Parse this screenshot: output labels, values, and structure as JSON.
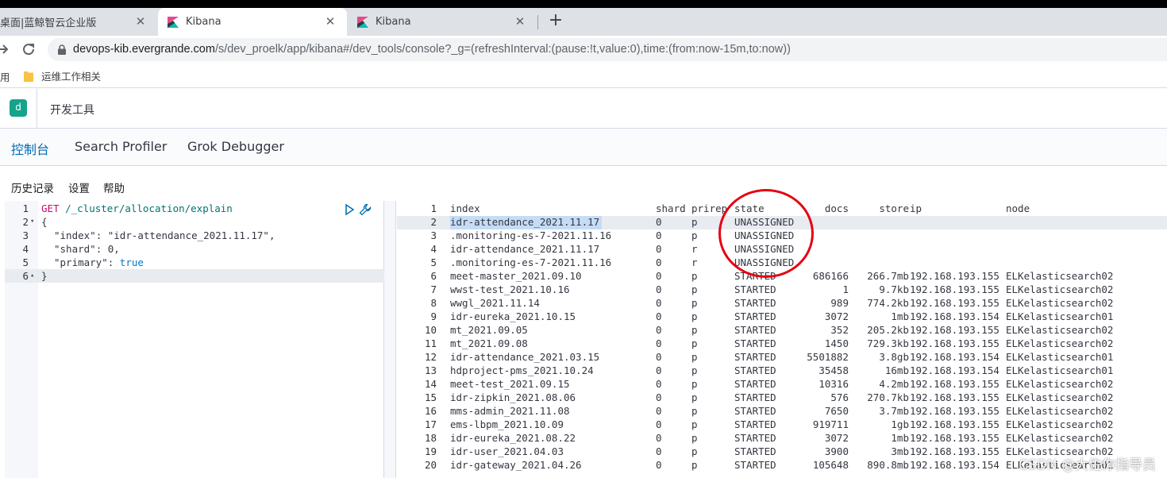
{
  "browser": {
    "tabs": [
      {
        "title": "桌面|蓝鲸智云企业版",
        "active": false
      },
      {
        "title": "Kibana",
        "active": true
      },
      {
        "title": "Kibana",
        "active": false
      }
    ],
    "close_glyph": "✕",
    "new_tab_glyph": "+",
    "url_host": "devops-kib.evergrande.com",
    "url_path": "/s/dev_proelk/app/kibana#/dev_tools/console?_g=(refreshInterval:(pause:!t,value:0),time:(from:now-15m,to:now))",
    "bookmarks": {
      "apps_label": "用",
      "folder_label": "运维工作相关"
    }
  },
  "kibana": {
    "space_initial": "d",
    "app_title": "开发工具",
    "tabs": [
      "控制台",
      "Search Profiler",
      "Grok Debugger"
    ],
    "active_tab": 0,
    "subnav": [
      "历史记录",
      "设置",
      "帮助"
    ]
  },
  "request": {
    "lines": [
      {
        "num": "1",
        "fold": "",
        "method": "GET",
        "path": " /_cluster/allocation/explain"
      },
      {
        "num": "2",
        "fold": "▾",
        "text": "{"
      },
      {
        "num": "3",
        "fold": "",
        "key": "\"index\"",
        "sep": ": ",
        "value": "\"idr-attendance_2021.11.17\"",
        "tail": ","
      },
      {
        "num": "4",
        "fold": "",
        "key": "\"shard\"",
        "sep": ": ",
        "value": "0",
        "tail": ","
      },
      {
        "num": "5",
        "fold": "",
        "key": "\"primary\"",
        "sep": ": ",
        "value": "true",
        "tail": ""
      },
      {
        "num": "6",
        "fold": "▴",
        "text": "}"
      }
    ]
  },
  "response": {
    "headers": [
      "index",
      "shard",
      "prirep",
      "state",
      "docs",
      "store",
      "ip",
      "node"
    ],
    "rows": [
      [
        "idr-attendance_2021.11.17",
        "0",
        "p",
        "UNASSIGNED",
        "",
        "",
        "",
        ""
      ],
      [
        ".monitoring-es-7-2021.11.16",
        "0",
        "p",
        "UNASSIGNED",
        "",
        "",
        "",
        ""
      ],
      [
        "idr-attendance_2021.11.17",
        "0",
        "r",
        "UNASSIGNED",
        "",
        "",
        "",
        ""
      ],
      [
        ".monitoring-es-7-2021.11.16",
        "0",
        "r",
        "UNASSIGNED",
        "",
        "",
        "",
        ""
      ],
      [
        "meet-master_2021.09.10",
        "0",
        "p",
        "STARTED",
        "686166",
        "266.7mb",
        "192.168.193.155",
        "ELKelasticsearch02"
      ],
      [
        "wwst-test_2021.10.16",
        "0",
        "p",
        "STARTED",
        "1",
        "9.7kb",
        "192.168.193.155",
        "ELKelasticsearch02"
      ],
      [
        "wwgl_2021.11.14",
        "0",
        "p",
        "STARTED",
        "989",
        "774.2kb",
        "192.168.193.155",
        "ELKelasticsearch02"
      ],
      [
        "idr-eureka_2021.10.15",
        "0",
        "p",
        "STARTED",
        "3072",
        "1mb",
        "192.168.193.154",
        "ELKelasticsearch01"
      ],
      [
        "mt_2021.09.05",
        "0",
        "p",
        "STARTED",
        "352",
        "205.2kb",
        "192.168.193.155",
        "ELKelasticsearch02"
      ],
      [
        "mt_2021.09.08",
        "0",
        "p",
        "STARTED",
        "1450",
        "729.3kb",
        "192.168.193.155",
        "ELKelasticsearch02"
      ],
      [
        "idr-attendance_2021.03.15",
        "0",
        "p",
        "STARTED",
        "5501882",
        "3.8gb",
        "192.168.193.154",
        "ELKelasticsearch01"
      ],
      [
        "hdproject-pms_2021.10.24",
        "0",
        "p",
        "STARTED",
        "35458",
        "16mb",
        "192.168.193.154",
        "ELKelasticsearch01"
      ],
      [
        "meet-test_2021.09.15",
        "0",
        "p",
        "STARTED",
        "10316",
        "4.2mb",
        "192.168.193.155",
        "ELKelasticsearch02"
      ],
      [
        "idr-zipkin_2021.08.06",
        "0",
        "p",
        "STARTED",
        "576",
        "270.7kb",
        "192.168.193.155",
        "ELKelasticsearch02"
      ],
      [
        "mms-admin_2021.11.08",
        "0",
        "p",
        "STARTED",
        "7650",
        "3.7mb",
        "192.168.193.155",
        "ELKelasticsearch02"
      ],
      [
        "ems-lbpm_2021.10.09",
        "0",
        "p",
        "STARTED",
        "919711",
        "1gb",
        "192.168.193.155",
        "ELKelasticsearch02"
      ],
      [
        "idr-eureka_2021.08.22",
        "0",
        "p",
        "STARTED",
        "3072",
        "1mb",
        "192.168.193.155",
        "ELKelasticsearch02"
      ],
      [
        "idr-user_2021.04.03",
        "0",
        "p",
        "STARTED",
        "3900",
        "3mb",
        "192.168.193.155",
        "ELKelasticsearch02"
      ],
      [
        "idr-gateway_2021.04.26",
        "0",
        "p",
        "STARTED",
        "105648",
        "890.8mb",
        "192.168.193.154",
        "ELKelasticsearch01"
      ]
    ]
  },
  "watermark": "CSDN @大佐你指导员",
  "colors": {
    "accent": "#006bb4",
    "annotation": "#e60012",
    "space_badge": "#16a38c"
  }
}
